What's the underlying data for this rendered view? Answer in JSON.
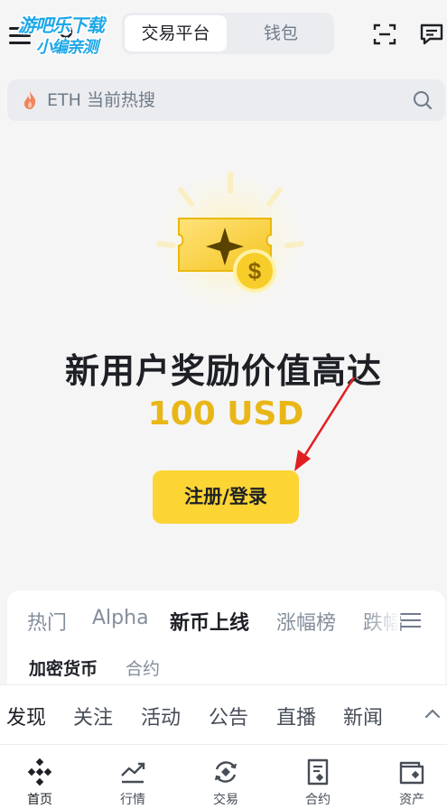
{
  "header": {
    "segment_active": "交易平台",
    "segment_inactive": "钱包",
    "watermark_line1": "游吧乐下载",
    "watermark_line2": "小编亲测"
  },
  "search": {
    "placeholder": "ETH 当前热搜"
  },
  "hero": {
    "title": "新用户奖励价值高达",
    "amount": "100 USD",
    "cta_label": "注册/登录"
  },
  "market": {
    "tabs": [
      {
        "label": "热门"
      },
      {
        "label": "Alpha"
      },
      {
        "label": "新币上线"
      },
      {
        "label": "涨幅榜"
      },
      {
        "label": "跌幅"
      }
    ],
    "active_tab": "新币上线",
    "subtabs": [
      {
        "label": "加密货币"
      },
      {
        "label": "合约"
      }
    ]
  },
  "feed": {
    "tabs": [
      {
        "label": "发现"
      },
      {
        "label": "关注"
      },
      {
        "label": "活动"
      },
      {
        "label": "公告"
      },
      {
        "label": "直播"
      },
      {
        "label": "新闻"
      }
    ]
  },
  "bottom_nav": {
    "items": [
      {
        "label": "首页",
        "icon": "binance-logo-icon"
      },
      {
        "label": "行情",
        "icon": "chart-trend-icon"
      },
      {
        "label": "交易",
        "icon": "exchange-icon"
      },
      {
        "label": "合约",
        "icon": "contract-doc-icon"
      },
      {
        "label": "资产",
        "icon": "wallet-icon"
      }
    ]
  },
  "colors": {
    "brand_yellow": "#fcd535",
    "amount_gold": "#e8b717",
    "text_primary": "#1e2026",
    "text_secondary": "#848e9c",
    "annotation_red": "#e02020"
  }
}
